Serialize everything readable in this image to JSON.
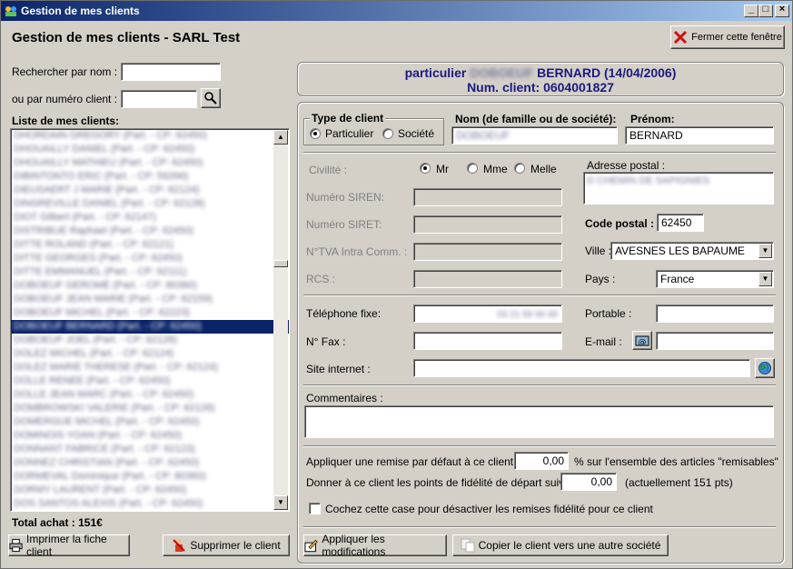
{
  "window": {
    "title": "Gestion de mes clients"
  },
  "header": {
    "title": "Gestion de mes clients - SARL Test",
    "close_label": "Fermer cette fenêtre"
  },
  "search": {
    "by_name_label": "Rechercher par nom :",
    "by_name_value": "",
    "by_number_label": "ou par numéro client :",
    "by_number_value": ""
  },
  "client_list": {
    "label": "Liste de mes clients:",
    "items": [
      "DHORDAIN GREGORY (Part. - CP: 62450)",
      "DHOUAILLY DANIEL (Part. - CP: 62450)",
      "DHOUAILLY MATHIEU (Part. - CP: 62450)",
      "DIBINTONTO ERIC (Part. - CP: 59266)",
      "DIEUSAERT J MARIE (Part. - CP: 62124)",
      "DINGREVILLE DANIEL (Part. - CP: 62128)",
      "DIOT Gilbert (Part. - CP: 62147)",
      "DISTRIBUE Raphael (Part. - CP: 62450)",
      "DITTE ROLAND (Part. - CP: 62121)",
      "DITTE GEORGES (Part. - CP: 62450)",
      "DITTE EMMANUEL (Part. - CP: 62111)",
      "DOBOEUF GEROME (Part. - CP: 80360)",
      "DOBOEUF JEAN MARIE (Part. - CP: 62159)",
      "DOBOEUF MICHEL (Part. - CP: 62223)",
      "DOBOEUF BERNARD (Part. - CP: 62450)",
      "DOBOEUF JOEL (Part. - CP: 62128)",
      "DOLEZ MICHEL (Part. - CP: 62124)",
      "DOLEZ MARIE THERESE (Part. - CP: 62124)",
      "DOLLE RENEE (Part. - CP: 62450)",
      "DOLLE JEAN MARC (Part. - CP: 62450)",
      "DOMBROWSKI VALERIE (Part. - CP: 62128)",
      "DOMERGUE MICHEL (Part. - CP: 62450)",
      "DOMINOIS YOAN (Part. - CP: 62450)",
      "DONNANT FABRICE (Part. - CP: 62123)",
      "DONNEZ CHRISTIAN (Part. - CP: 62450)",
      "DORMEVAL Dominique (Part. - CP: 80360)",
      "DORMY LAURENT (Part. - CP: 62450)",
      "DOS SANTOS ALEXIS (Part. - CP: 62450)"
    ],
    "selected_index": 14
  },
  "total_achat": "Total achat : 151€",
  "left_buttons": {
    "print": "Imprimer la fiche client",
    "delete": "Supprimer le client"
  },
  "client_header": {
    "line1_prefix": "particulier",
    "line1_name": "DOBOEUF",
    "line1_suffix": "BERNARD (14/04/2006)",
    "line2": "Num. client: 0604001827"
  },
  "form": {
    "type_label": "Type de client",
    "type_options": [
      "Particulier",
      "Société"
    ],
    "type_selected": "Particulier",
    "nom_label": "Nom (de famille ou de société):",
    "nom_value": "DOBOEUF",
    "prenom_label": "Prénom:",
    "prenom_value": "BERNARD",
    "civilite_label": "Civilité :",
    "civilite_options": [
      "Mr",
      "Mme",
      "Melle"
    ],
    "civilite_selected": "Mr",
    "siren_label": "Numéro SIREN:",
    "siret_label": "Numéro SIRET:",
    "tva_label": "N°TVA Intra Comm. :",
    "rcs_label": "RCS :",
    "adresse_label": "Adresse postal :",
    "adresse_value": "D CHEMIN DE SAPIGNIES",
    "cp_label": "Code postal :",
    "cp_value": "62450",
    "ville_label": "Ville :",
    "ville_value": "AVESNES LES BAPAUME",
    "pays_label": "Pays :",
    "pays_value": "France",
    "tel_label": "Téléphone fixe:",
    "tel_value": "03 21 59 00 00",
    "portable_label": "Portable :",
    "portable_value": "",
    "fax_label": "N° Fax :",
    "fax_value": "",
    "email_label": "E-mail :",
    "email_value": "",
    "site_label": "Site internet :",
    "site_value": "",
    "commentaires_label": "Commentaires :",
    "commentaires_value": "",
    "remise_label": "Appliquer une remise par défaut à ce client de :",
    "remise_value": "0,00",
    "remise_suffix": "% sur l'ensemble des articles \"remisables\"",
    "fidelite_label": "Donner à ce client les points de fidélité de départ suivant :",
    "fidelite_value": "0,00",
    "fidelite_suffix": "(actuellement 151 pts)",
    "checkbox_label": "Cochez cette case pour désactiver les remises fidélité pour ce client"
  },
  "right_buttons": {
    "apply": "Appliquer les modifications",
    "copy": "Copier le client vers une autre société"
  },
  "colors": {
    "window_bg": "#d4d0c8",
    "title_bar": "#0a246a",
    "header_text": "#1a1a80",
    "selection": "#0a246a"
  }
}
